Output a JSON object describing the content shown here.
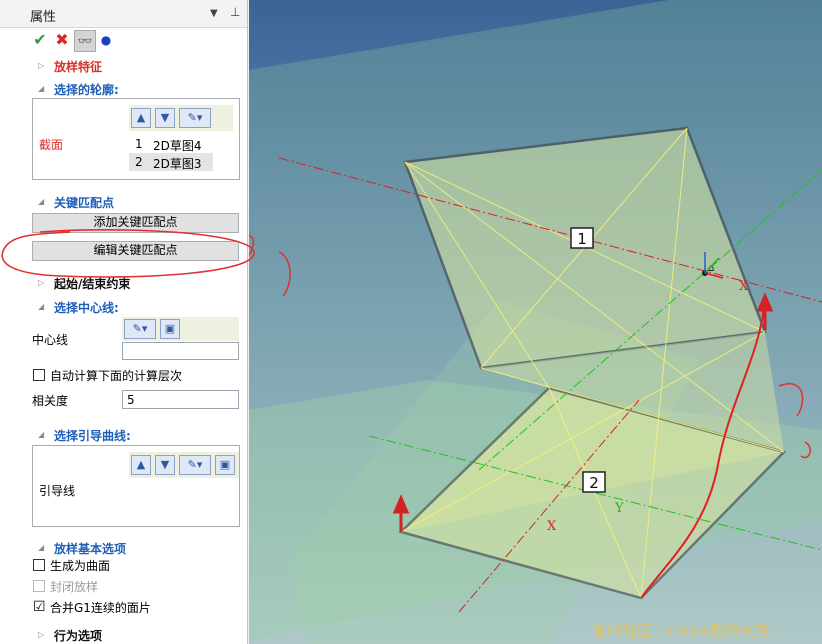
{
  "panel": {
    "title": "属性",
    "toolbar": {
      "ok": "✔",
      "cancel": "✖",
      "preview": "👓",
      "dot": "●"
    },
    "sections": {
      "loft_feature": "放样特征",
      "selected_profiles": "选择的轮廓:",
      "key_points": "关键匹配点",
      "start_end": "起始/结束约束",
      "select_centerline": "选择中心线:",
      "select_guides": "选择引导曲线:",
      "basic_options": "放样基本选项",
      "behavior_options": "行为选项"
    },
    "profiles": {
      "label": "截面",
      "items": [
        {
          "index": "1",
          "name": "2D草图4"
        },
        {
          "index": "2",
          "name": "2D草图3"
        }
      ]
    },
    "buttons": {
      "add_key_point": "添加关键匹配点",
      "edit_key_point": "编辑关键匹配点"
    },
    "centerline": {
      "label": "中心线",
      "value": ""
    },
    "auto_calc": "自动计算下面的计算层次",
    "relevance": {
      "label": "相关度",
      "value": "5"
    },
    "guides": {
      "label": "引导线"
    },
    "options": {
      "make_surface": "生成为曲面",
      "closed_loft": "封闭放样",
      "merge_g1": "合并G1连续的面片",
      "merge_g1_checked": "☑"
    }
  },
  "viewport": {
    "profile_labels": [
      "1",
      "2"
    ],
    "axis_labels": {
      "x": "X",
      "y": "Y",
      "z": "Z"
    },
    "origin_label": "⌂",
    "watermark": "咖啡社区 | CAXA数码大方"
  },
  "colors": {
    "section_blue": "#1f5fb8",
    "section_red": "#d4312a",
    "viewport_bg_top": "#3b6496",
    "viewport_bg_bottom": "#b3c2d8",
    "loft_fill": "#d9e6a0"
  }
}
